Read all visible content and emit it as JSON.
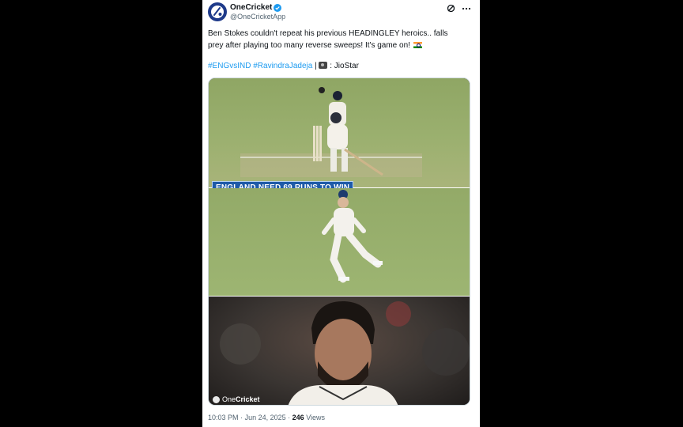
{
  "account": {
    "display_name": "OneCricket",
    "handle": "@OneCricketApp"
  },
  "tweet": {
    "text": "Ben Stokes couldn't repeat his previous HEADINGLEY heroics.. falls prey after playing too many reverse sweeps! It's game on!",
    "hashtags": [
      "#ENGvsIND",
      "#RavindraJadeja"
    ],
    "separator": "|",
    "credit": ": JioStar"
  },
  "media": {
    "banner_text": "ENGLAND NEED 69  RUNS TO WIN",
    "watermark_prefix": "One",
    "watermark_suffix": "Cricket"
  },
  "footer": {
    "time": "10:03 PM",
    "dot": "·",
    "date": "Jun 24, 2025",
    "views_count": "246",
    "views_label": "Views"
  },
  "icons": {
    "avatar": "cricket-ball-logo",
    "verified": "verified-badge-icon",
    "grok": "grok-icon",
    "more": "more-icon",
    "camera": "camera-icon",
    "flag": "india-flag-icon"
  },
  "colors": {
    "link": "#1d9bf0",
    "verified": "#1d9bf0",
    "banner": "#1e5aa8"
  }
}
